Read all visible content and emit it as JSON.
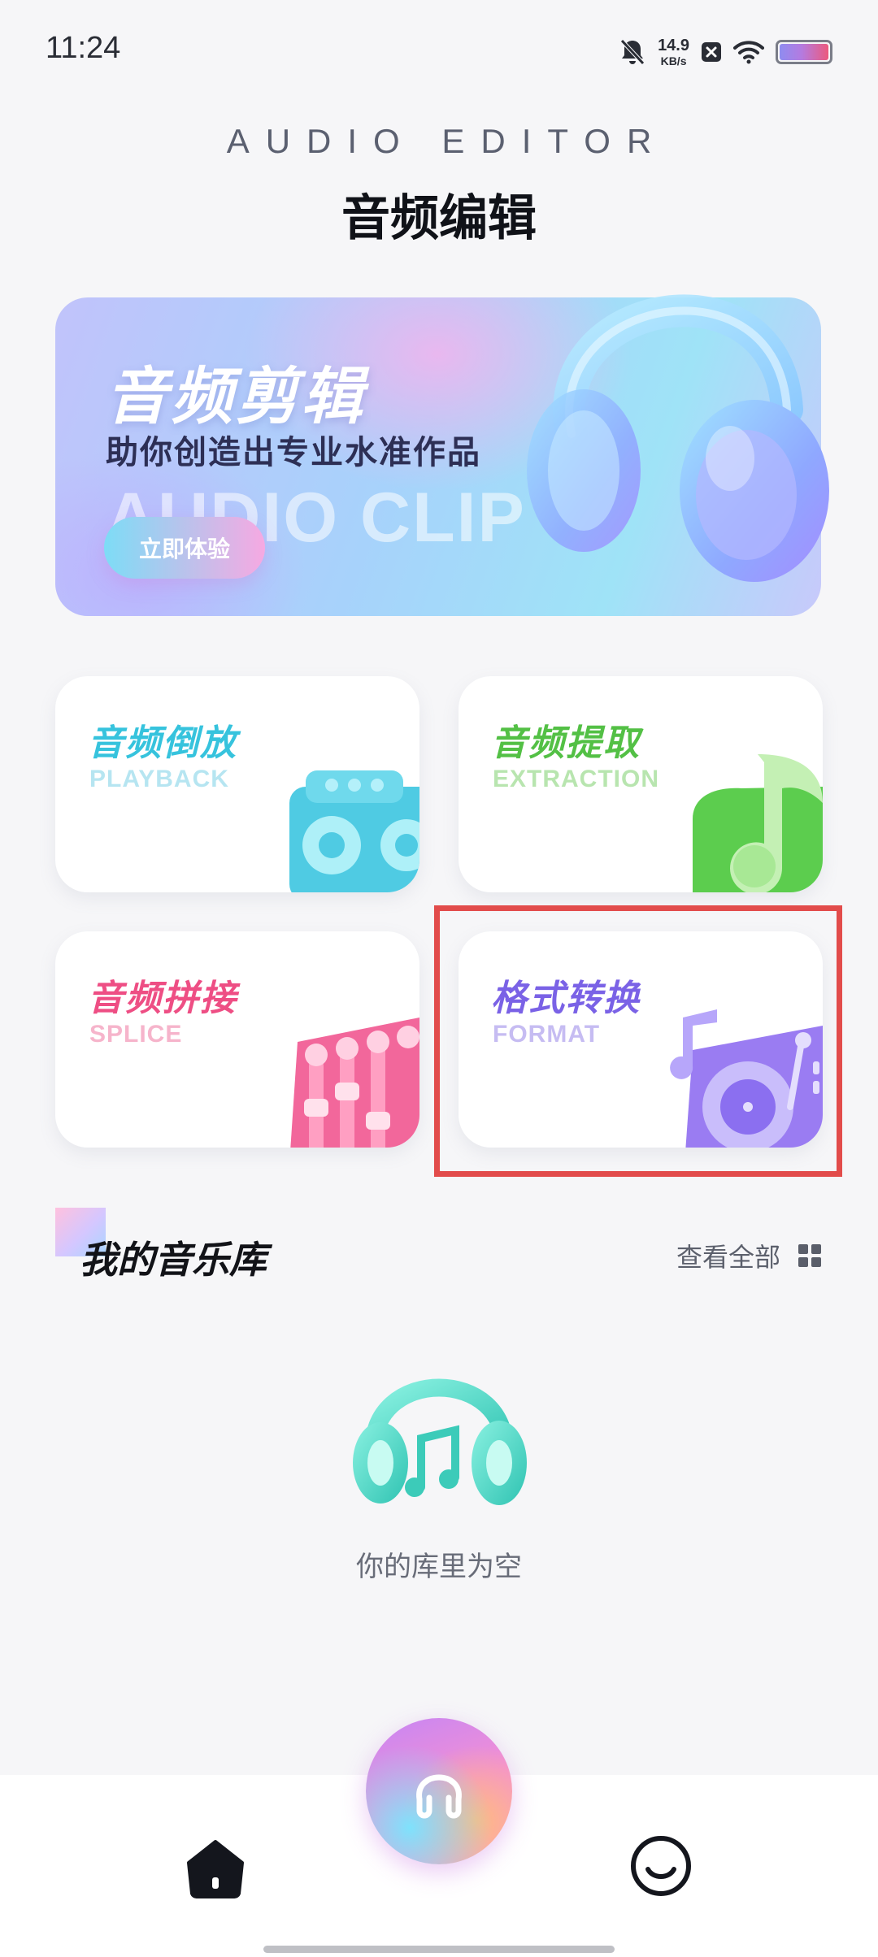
{
  "status_bar": {
    "time": "11:24",
    "net_speed_value": "14.9",
    "net_speed_unit": "KB/s",
    "icons": [
      "bell-muted-icon",
      "close-box-icon",
      "wifi-icon",
      "battery-icon"
    ]
  },
  "header": {
    "subtitle": "AUDIO EDITOR",
    "title": "音频编辑"
  },
  "banner": {
    "title": "音频剪辑",
    "description": "助你创造出专业水准作品",
    "watermark": "AUDIO CLIP",
    "button_label": "立即体验"
  },
  "tools": [
    {
      "cn": "音频倒放",
      "en": "PLAYBACK",
      "accent": "#36c3dd",
      "icon": "tape-recorder-icon"
    },
    {
      "cn": "音频提取",
      "en": "EXTRACTION",
      "accent": "#53c045",
      "icon": "music-note-icon"
    },
    {
      "cn": "音频拼接",
      "en": "SPLICE",
      "accent": "#ee4e84",
      "icon": "mixer-icon"
    },
    {
      "cn": "格式转换",
      "en": "FORMAT",
      "accent": "#7a62e6",
      "icon": "turntable-icon"
    }
  ],
  "library": {
    "title": "我的音乐库",
    "view_all": "查看全部",
    "empty_text": "你的库里为空"
  },
  "colors": {
    "highlight": "#e24c4b",
    "background": "#f6f6f8"
  },
  "bottom_nav": {
    "items": [
      "home-icon",
      "headphones-icon",
      "smile-face-icon"
    ],
    "active": "home-icon"
  }
}
